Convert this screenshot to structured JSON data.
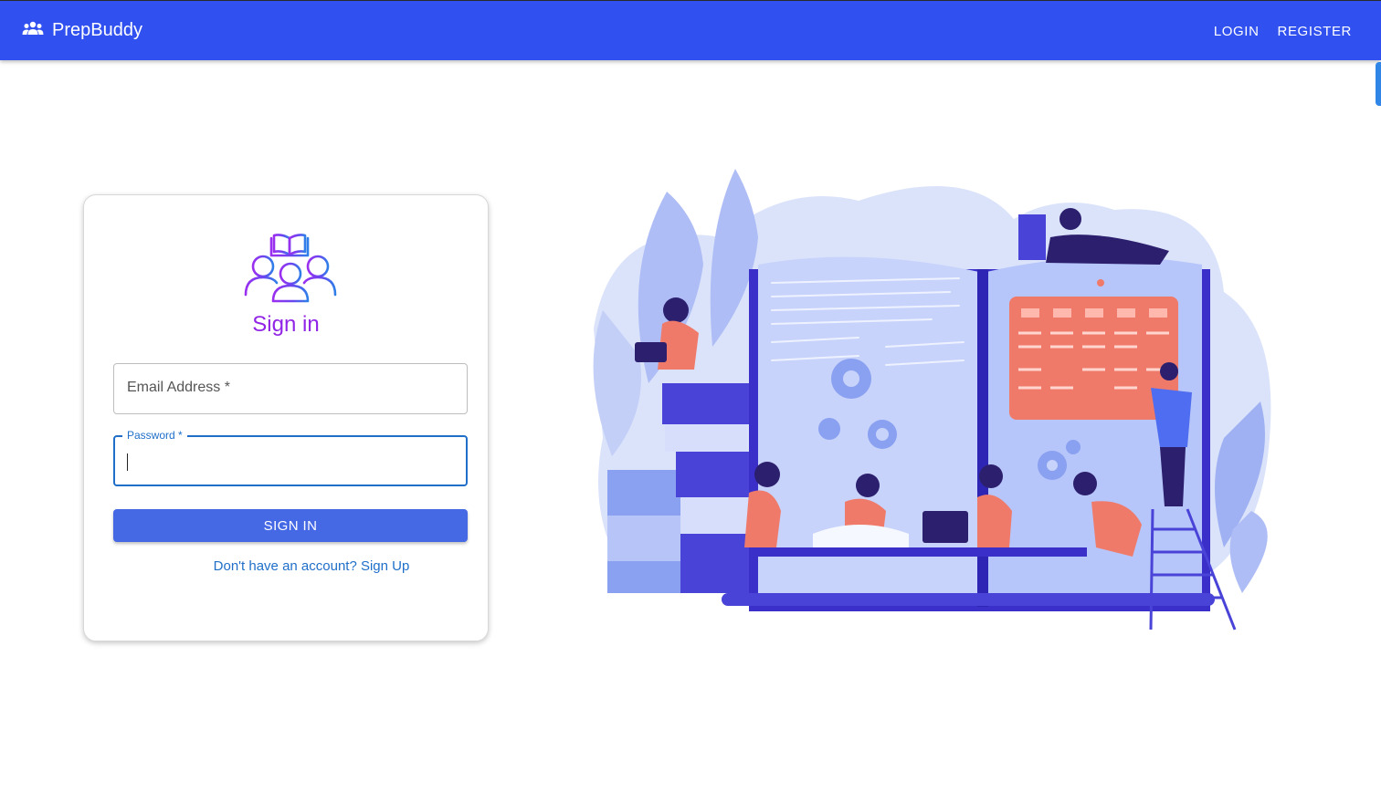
{
  "header": {
    "app_name": "PrepBuddy",
    "nav": {
      "login": "LOGIN",
      "register": "REGISTER"
    },
    "brand_icon": "group-people-icon",
    "bar_color": "#3050ef"
  },
  "signin_card": {
    "title": "Sign in",
    "logo_icon": "study-group-book-icon",
    "email": {
      "label": "Email Address *",
      "value": ""
    },
    "password": {
      "label": "Password *",
      "value": ""
    },
    "submit_label": "SIGN IN",
    "signup_link": "Don't have an account? Sign Up",
    "accent_color": "#9124e6",
    "button_color": "#4568e5"
  },
  "illustration": {
    "name": "study-group-illustration"
  }
}
